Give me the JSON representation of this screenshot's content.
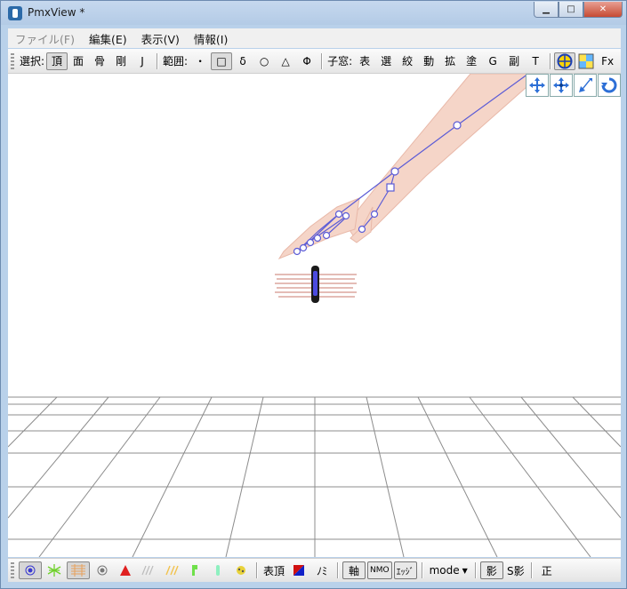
{
  "window": {
    "title": "PmxView *"
  },
  "menu": [
    {
      "label": "ファイル(F)",
      "disabled": true
    },
    {
      "label": "編集(E)",
      "disabled": false
    },
    {
      "label": "表示(V)",
      "disabled": false
    },
    {
      "label": "情報(I)",
      "disabled": false
    }
  ],
  "toolbar": {
    "select_label": "選択:",
    "select_items": [
      "頂",
      "面",
      "骨",
      "剛",
      "J"
    ],
    "range_label": "範囲:",
    "range_items": [
      "・",
      "□",
      "δ",
      "○",
      "△",
      "Φ"
    ],
    "child_label": "子窓:",
    "child_items": [
      "表",
      "選",
      "絞",
      "動",
      "拡",
      "塗",
      "G",
      "副",
      "T"
    ],
    "fx_label": "Fx"
  },
  "bottombar": {
    "vertex_table": "表頂",
    "nomi": "ﾉﾐ",
    "axis": "軸",
    "nmo": "NMO",
    "edge": "ｴｯｼﾞ",
    "mode": "mode",
    "shadow": "影",
    "sshadow": "S影",
    "sei": "正"
  },
  "colors": {
    "bone": "#5b5bd6",
    "skin": "#f5d5c8",
    "grid": "#8c8c8c"
  },
  "icons": {
    "viewport_tools": [
      "move-xy-icon",
      "move-xyz-icon",
      "move-z-icon",
      "rotate-icon"
    ]
  }
}
